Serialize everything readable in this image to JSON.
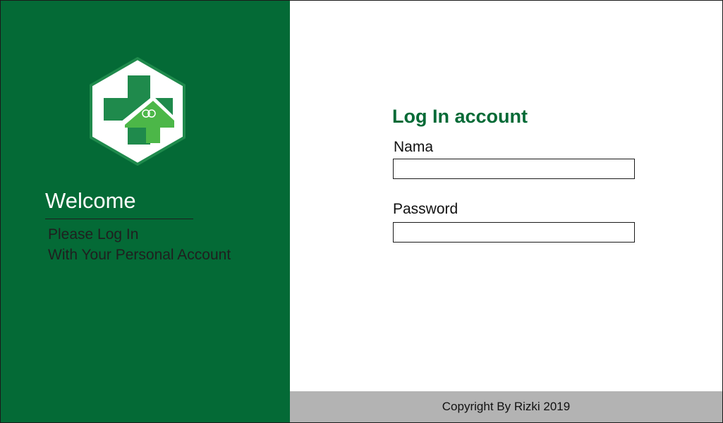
{
  "sidebar": {
    "logo": "health-clinic-logo",
    "welcome_title": "Welcome",
    "subtitle_line1": "Please Log In",
    "subtitle_line2": "With Your Personal Account"
  },
  "form": {
    "title": "Log In account",
    "nama_label": "Nama",
    "nama_value": "",
    "password_label": "Password",
    "password_value": ""
  },
  "footer": {
    "copyright": "Copyright By Rizki 2019"
  },
  "colors": {
    "brand_green": "#046a36",
    "logo_green_dark": "#1f8a4c",
    "logo_green_light": "#4cb748",
    "footer_gray": "#b3b3b3"
  }
}
